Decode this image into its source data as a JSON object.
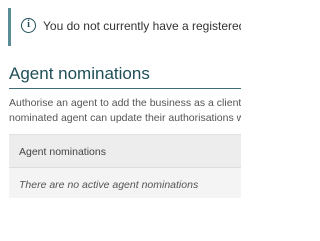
{
  "notice": {
    "icon": "info-icon",
    "icon_glyph": "i",
    "text": "You do not currently have a registered agent"
  },
  "agent_nominations": {
    "heading": "Agent nominations",
    "intro_line_1": "Authorise an agent to add the business as a client",
    "intro_line_2": "nominated agent can update their authorisations w",
    "table": {
      "column_header": "Agent nominations",
      "empty_message": "There are no active agent nominations"
    }
  },
  "colors": {
    "accent": "#1f4e57",
    "notice_border": "#5a8c95",
    "table_background": "#f4f4f4"
  }
}
